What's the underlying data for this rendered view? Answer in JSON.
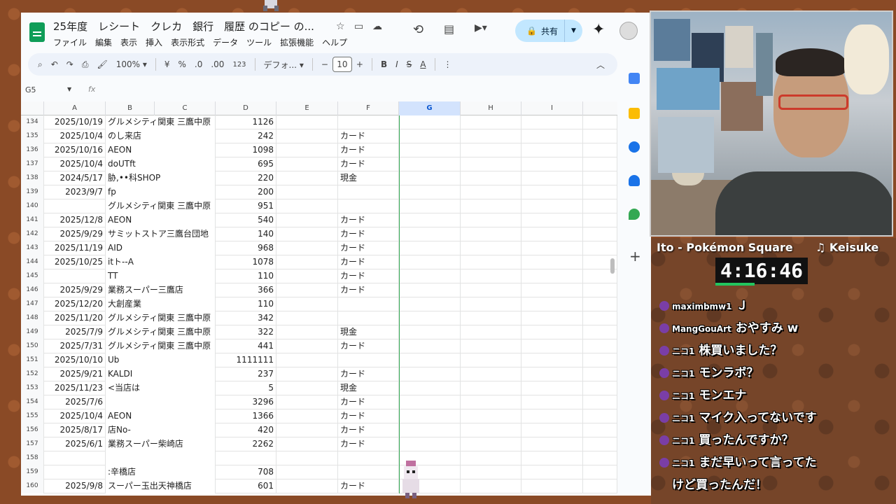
{
  "sheets": {
    "doc_title": "25年度　レシート　クレカ　銀行　履歴 のコピー の...",
    "menu": [
      "ファイル",
      "編集",
      "表示",
      "挿入",
      "表示形式",
      "データ",
      "ツール",
      "拡張機能",
      "ヘルプ"
    ],
    "share_label": "共有",
    "toolbar": {
      "zoom": "100%",
      "currency": "¥",
      "percent": "%",
      "dec_less": ".0",
      "dec_more": ".00",
      "num_format": "123",
      "font": "デフォ...",
      "font_size": "10"
    },
    "name_box": "G5",
    "fx": "fx",
    "columns": [
      "A",
      "B",
      "C",
      "D",
      "E",
      "F",
      "G",
      "H",
      "I"
    ],
    "selected_column": "G",
    "rows": [
      {
        "n": "134",
        "a": "2025/10/19",
        "b": "グルメシティ関東 三鷹中原",
        "d": "1126",
        "f": ""
      },
      {
        "n": "135",
        "a": "2025/10/4",
        "b": "のし来店",
        "d": "242",
        "f": "カード"
      },
      {
        "n": "136",
        "a": "2025/10/16",
        "b": "AEON",
        "d": "1098",
        "f": "カード"
      },
      {
        "n": "137",
        "a": "2025/10/4",
        "b": "doUTft",
        "d": "695",
        "f": "カード"
      },
      {
        "n": "138",
        "a": "2024/5/17",
        "b": "胁,••科SHOP",
        "d": "220",
        "f": "現金"
      },
      {
        "n": "139",
        "a": "2023/9/7",
        "b": "fp",
        "d": "200",
        "f": ""
      },
      {
        "n": "140",
        "a": "",
        "b": "グルメシティ関東 三鷹中原",
        "d": "951",
        "f": ""
      },
      {
        "n": "141",
        "a": "2025/12/8",
        "b": "AEON",
        "d": "540",
        "f": "カード"
      },
      {
        "n": "142",
        "a": "2025/9/29",
        "b": "サミットストア三鷹台団地",
        "d": "140",
        "f": "カード"
      },
      {
        "n": "143",
        "a": "2025/11/19",
        "b": "AID",
        "d": "968",
        "f": "カード"
      },
      {
        "n": "144",
        "a": "2025/10/25",
        "b": "itト--A",
        "d": "1078",
        "f": "カード"
      },
      {
        "n": "145",
        "a": "",
        "b": "TT",
        "d": "110",
        "f": "カード"
      },
      {
        "n": "146",
        "a": "2025/9/29",
        "b": "業務スーパー三鷹店",
        "d": "366",
        "f": "カード"
      },
      {
        "n": "147",
        "a": "2025/12/20",
        "b": "大創産業",
        "d": "110",
        "f": ""
      },
      {
        "n": "148",
        "a": "2025/11/20",
        "b": "グルメシティ関東 三鷹中原",
        "d": "342",
        "f": ""
      },
      {
        "n": "149",
        "a": "2025/7/9",
        "b": "グルメシティ関東 三鷹中原",
        "d": "322",
        "f": "現金"
      },
      {
        "n": "150",
        "a": "2025/7/31",
        "b": "グルメシティ関東 三鷹中原",
        "d": "441",
        "f": "カード"
      },
      {
        "n": "151",
        "a": "2025/10/10",
        "b": "Ub",
        "d": "1111111",
        "f": ""
      },
      {
        "n": "152",
        "a": "2025/9/21",
        "b": "KALDI",
        "d": "237",
        "f": "カード"
      },
      {
        "n": "153",
        "a": "2025/11/23",
        "b": "<当店は",
        "d": "5",
        "f": "現金"
      },
      {
        "n": "154",
        "a": "2025/7/6",
        "b": "",
        "d": "3296",
        "f": "カード"
      },
      {
        "n": "155",
        "a": "2025/10/4",
        "b": "AEON",
        "d": "1366",
        "f": "カード"
      },
      {
        "n": "156",
        "a": "2025/8/17",
        "b": "店No-",
        "d": "420",
        "f": "カード"
      },
      {
        "n": "157",
        "a": "2025/6/1",
        "b": "業務スーパー柴崎店",
        "d": "2262",
        "f": "カード"
      },
      {
        "n": "158",
        "a": "",
        "b": "",
        "d": "",
        "f": ""
      },
      {
        "n": "159",
        "a": "",
        "b": ":辛橋店",
        "d": "708",
        "f": ""
      },
      {
        "n": "160",
        "a": "2025/9/8",
        "b": "スーパー玉出天神橋店",
        "d": "601",
        "f": "カード"
      }
    ]
  },
  "overlay": {
    "now_playing": "Ito - Pokémon Square",
    "artist": "♫ Keisuke",
    "timer": "4:16:46",
    "chat": [
      {
        "user": "maximbmw1",
        "text": "Ｊ"
      },
      {
        "user": "MangGouArt",
        "text": "おやすみ w"
      },
      {
        "user": "ニコ1",
        "text": "株買いました？"
      },
      {
        "user": "ニコ1",
        "text": "モンラボ？"
      },
      {
        "user": "ニコ1",
        "text": "モンエナ"
      },
      {
        "user": "ニコ1",
        "text": "マイク入ってないです"
      },
      {
        "user": "ニコ1",
        "text": "買ったんですか？"
      },
      {
        "user": "ニコ1",
        "text": "まだ早いって言ってた"
      },
      {
        "user": "",
        "text": "けど買ったんだ！"
      }
    ]
  },
  "colors": {
    "sheets_green": "#0f9d58",
    "share_bg": "#c2e7ff",
    "selected_col": "#d3e3fd",
    "timer_bar": "#22c55e",
    "glasses": "#cc3b2b"
  }
}
